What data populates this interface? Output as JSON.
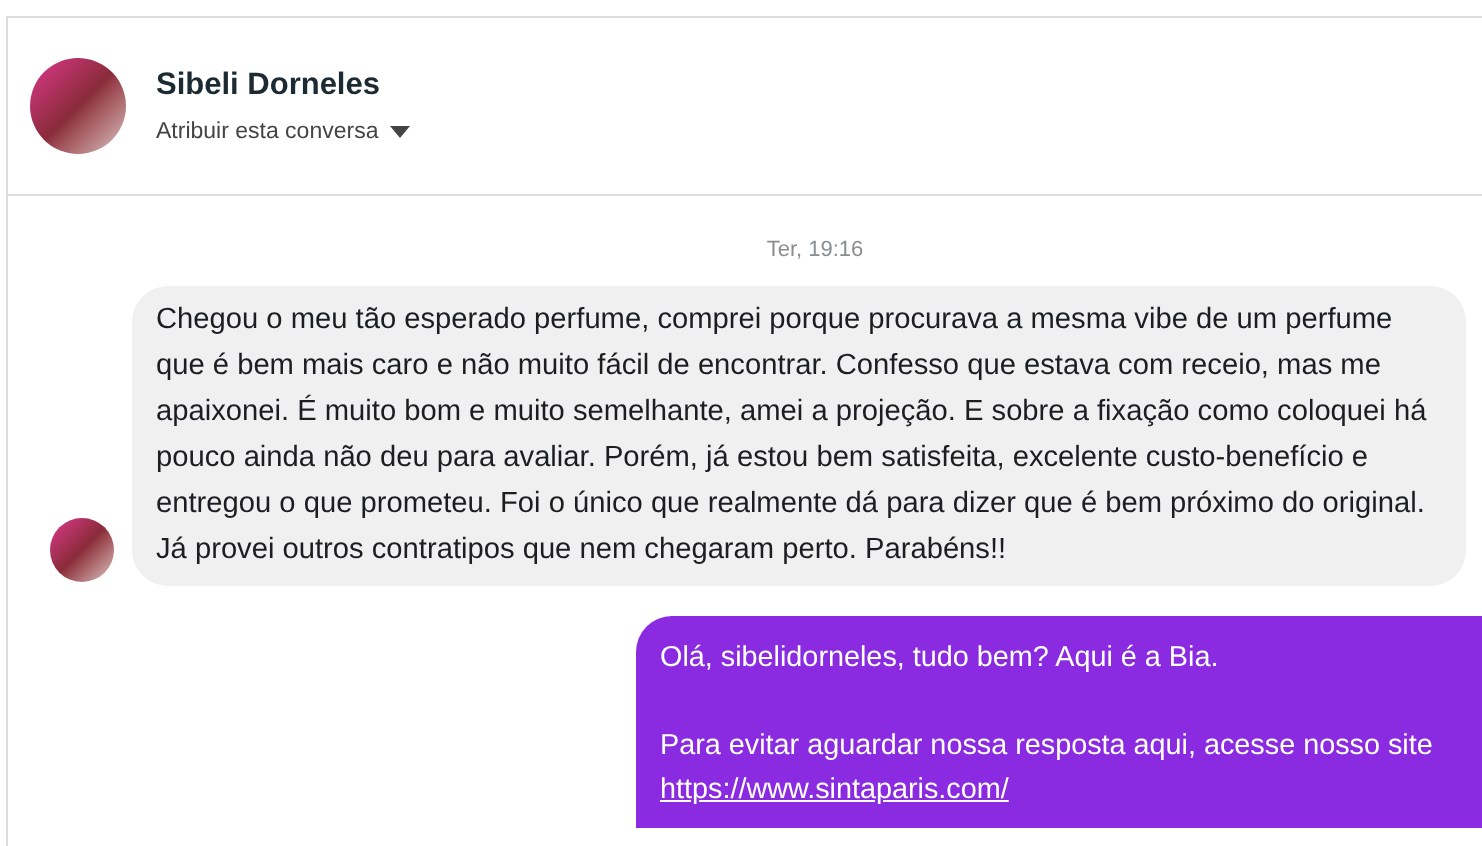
{
  "header": {
    "name": "Sibeli Dorneles",
    "assign_label": "Atribuir esta conversa"
  },
  "timestamp": "Ter, 19:16",
  "messages": [
    {
      "kind": "incoming",
      "text": "Chegou o meu tão esperado perfume, comprei porque procurava a mesma vibe de um perfume que é bem mais caro e não muito fácil de encontrar. Confesso que estava com receio, mas me apaixonei. É muito bom e muito semelhante, amei a projeção. E sobre a fixação como coloquei há pouco ainda não deu para avaliar. Porém, já estou bem satisfeita, excelente custo-benefício e entregou o que prometeu. Foi o único que realmente dá para dizer que é bem próximo do original. Já provei outros contratipos que nem chegaram perto. Parabéns!!"
    },
    {
      "kind": "outgoing",
      "lines": [
        "Olá, sibelidorneles, tudo bem? Aqui é a Bia.",
        "Para evitar aguardar nossa resposta aqui, acesse nosso site"
      ],
      "link": "https://www.sintaparis.com/"
    }
  ]
}
